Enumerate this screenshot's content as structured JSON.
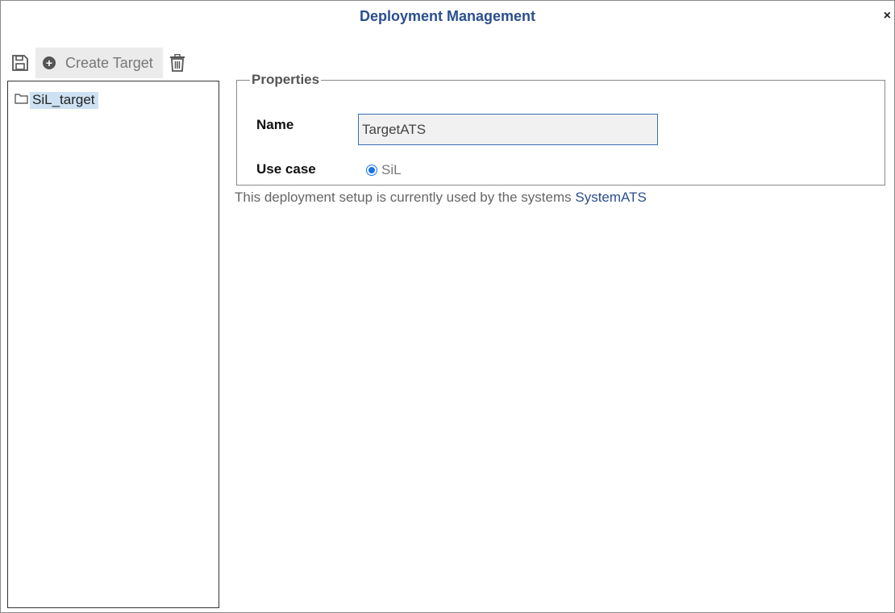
{
  "window": {
    "title": "Deployment Management",
    "close_glyph": "×"
  },
  "toolbar": {
    "save_icon": "save-icon",
    "create_label": "Create Target",
    "create_icon": "plus-circle-icon",
    "delete_icon": "trash-icon"
  },
  "tree": {
    "items": [
      {
        "label": "SiL_target",
        "icon": "folder-icon",
        "selected": true
      }
    ]
  },
  "properties": {
    "legend": "Properties",
    "name_label": "Name",
    "name_value": "TargetATS",
    "use_case_label": "Use case",
    "use_case_option": "SiL",
    "use_case_selected": true
  },
  "info": {
    "prefix": "This deployment setup is currently used by the systems",
    "system_link": "SystemATS"
  },
  "colors": {
    "title": "#2a4f8f",
    "selection": "#cde1f3",
    "radio": "#1a73e8"
  }
}
